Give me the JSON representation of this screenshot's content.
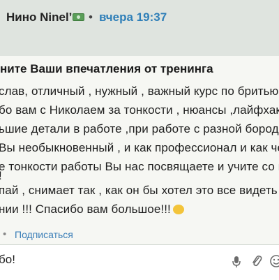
{
  "header": {
    "author": "Нино Ninel’",
    "separator": "•",
    "time": "вчера 19:37"
  },
  "post": {
    "title": "ните Ваши впечатления от тренинга",
    "lines": [
      "слав, отличный , нужный , важный курс по бритью !",
      "бо вам с Николаем за тонкости , нюансы ,лайфхаки",
      "ьшие детали в работе ,при работе с разной бородо",
      "Вы необыкновенный , и как профессионал и как чел",
      "е тонкости работы Вы нас посвящаете и учите со в",
      "!",
      "пай , снимает так , как он бы хотел это все видеть",
      "нии !!! Спасибо вам большое!!!"
    ]
  },
  "meta": {
    "dot": "•",
    "subscribe": "Подписаться"
  },
  "reply": {
    "text": "бо!"
  },
  "colors": {
    "link": "#2f7fb8",
    "badge": "#5a9e58"
  }
}
